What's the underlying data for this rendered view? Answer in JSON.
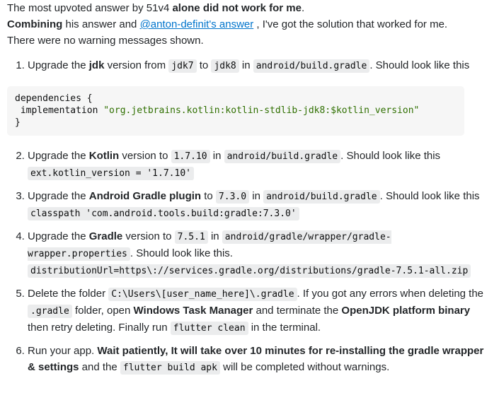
{
  "intro": {
    "line1_a": "The most upvoted answer by 51v4 ",
    "line1_b": "alone did not work for me",
    "line1_c": ".",
    "line2_bold": "Combining",
    "line2_a": " his answer and ",
    "line2_link": "@anton-definit's answer",
    "line2_b": " , I've got the solution that worked for me.",
    "line3": "There were no warning messages shown."
  },
  "steps": [
    {
      "a": "Upgrade the ",
      "b": "jdk",
      "c": " version from ",
      "code1": "jdk7",
      "d": " to ",
      "code2": "jdk8",
      "e": " in ",
      "code3": "android/build.gradle",
      "f": ". Should look like this"
    },
    {
      "a": "Upgrade the ",
      "b": "Kotlin",
      "c": " version to ",
      "code1": "1.7.10",
      "d": " in ",
      "code2": "android/build.gradle",
      "e": ". Should look like this",
      "code3": "ext.kotlin_version = '1.7.10'"
    },
    {
      "a": "Upgrade the ",
      "b": "Android Gradle plugin",
      "c": " to ",
      "code1": "7.3.0",
      "d": " in ",
      "code2": "android/build.gradle",
      "e": ". Should look like this ",
      "code3": "classpath 'com.android.tools.build:gradle:7.3.0'"
    },
    {
      "a": "Upgrade the ",
      "b": "Gradle",
      "c": " version to ",
      "code1": "7.5.1",
      "d": " in ",
      "code2": "android/gradle/wrapper/gradle-wrapper.properties",
      "e": ". Should look like this.",
      "code3": "distributionUrl=https\\://services.gradle.org/distributions/gradle-7.5.1-all.zip"
    },
    {
      "a": "Delete the folder ",
      "code1": "C:\\Users\\[user_name_here]\\.gradle",
      "b": ". If you got any errors when deleting the ",
      "code2": ".gradle",
      "c": " folder, open ",
      "d": "Windows Task Manager",
      "e": " and terminate the ",
      "f": "OpenJDK platform binary",
      "g": " then retry deleting. Finally run ",
      "code3": "flutter clean",
      "h": " in the terminal."
    },
    {
      "a": "Run your app. ",
      "b": "Wait patiently, It will take over 10 minutes for re-installing the gradle wrapper & settings",
      "c": " and the ",
      "code1": "flutter build apk",
      "d": " will be completed without warnings."
    }
  ],
  "codeblock": {
    "line1": "dependencies {",
    "line2_a": " implementation ",
    "line2_str": "\"org.jetbrains.kotlin:kotlin-stdlib-jdk8:$kotlin_version\"",
    "line3": "}"
  }
}
